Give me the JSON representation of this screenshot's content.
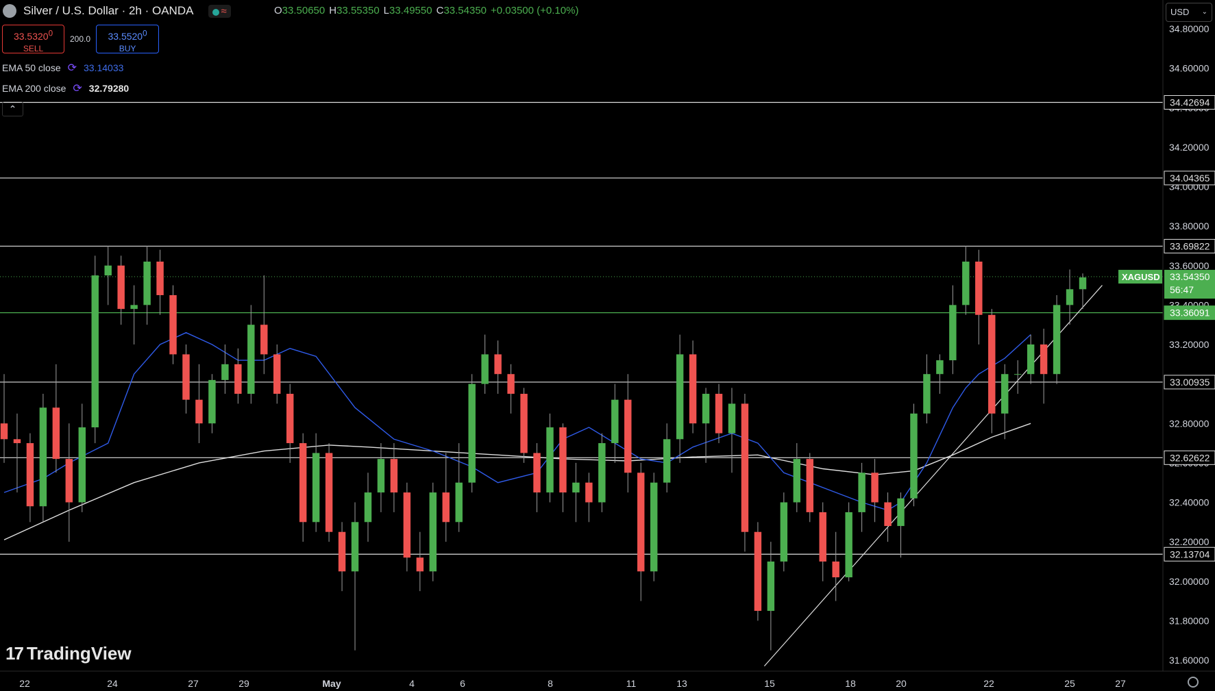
{
  "header": {
    "title": "Silver / U.S. Dollar · 2h · OANDA",
    "ohlc": {
      "o_label": "O",
      "o": "33.50650",
      "h_label": "H",
      "h": "33.55350",
      "l_label": "L",
      "l": "33.49550",
      "c_label": "C",
      "c": "33.54350",
      "change": "+0.03500 (+0.10%)"
    }
  },
  "trade": {
    "sell_price": "33.5320",
    "sell_price_small": "0",
    "sell_label": "SELL",
    "spread": "200.0",
    "buy_price": "33.5520",
    "buy_price_small": "0",
    "buy_label": "BUY"
  },
  "indicators": {
    "ema50_label": "EMA 50 close",
    "ema50_value": "33.14033",
    "ema200_label": "EMA 200 close",
    "ema200_value": "32.79280"
  },
  "currency_select": "USD",
  "collapse_icon": "chevron-up-icon",
  "brand": "TradingView",
  "colors": {
    "up": "#4caf50",
    "down": "#ef5350",
    "ema50": "#2f5bea",
    "ema200": "#e0e0e0",
    "last_price_badge": "#4caf50"
  },
  "chart_data": {
    "type": "candlestick",
    "symbol": "XAGUSD",
    "interval": "2h",
    "ylim": [
      31.55,
      34.85
    ],
    "y_ticks": [
      "34.80000",
      "34.60000",
      "34.40000",
      "34.20000",
      "34.00000",
      "33.80000",
      "33.60000",
      "33.40000",
      "33.20000",
      "33.00000",
      "32.80000",
      "32.60000",
      "32.40000",
      "32.20000",
      "32.00000",
      "31.80000",
      "31.60000"
    ],
    "x_tick_labels": [
      "22",
      "24",
      "27",
      "29",
      "May",
      "4",
      "6",
      "8",
      "11",
      "13",
      "15",
      "18",
      "20",
      "22",
      "25",
      "27"
    ],
    "horizontal_levels": [
      "34.42694",
      "34.04365",
      "33.69822",
      "33.36091",
      "33.00935",
      "32.62622",
      "32.13704"
    ],
    "highlighted_level": "33.36091",
    "last_price": {
      "symbol": "XAGUSD",
      "price": "33.54350",
      "countdown": "56:47"
    },
    "ema50_points": [
      [
        0,
        32.45
      ],
      [
        3,
        32.52
      ],
      [
        5,
        32.6
      ],
      [
        8,
        32.7
      ],
      [
        10,
        33.05
      ],
      [
        12,
        33.2
      ],
      [
        14,
        33.26
      ],
      [
        16,
        33.2
      ],
      [
        18,
        33.12
      ],
      [
        20,
        33.12
      ],
      [
        22,
        33.18
      ],
      [
        24,
        33.14
      ],
      [
        27,
        32.88
      ],
      [
        30,
        32.72
      ],
      [
        33,
        32.66
      ],
      [
        36,
        32.58
      ],
      [
        38,
        32.5
      ],
      [
        41,
        32.55
      ],
      [
        43,
        32.72
      ],
      [
        45,
        32.78
      ],
      [
        47,
        32.7
      ],
      [
        49,
        32.62
      ],
      [
        51,
        32.6
      ],
      [
        53,
        32.68
      ],
      [
        56,
        32.75
      ],
      [
        58,
        32.7
      ],
      [
        60,
        32.55
      ],
      [
        62,
        32.5
      ],
      [
        64,
        32.45
      ],
      [
        66,
        32.4
      ],
      [
        68,
        32.36
      ],
      [
        69,
        32.4
      ],
      [
        71,
        32.6
      ],
      [
        73,
        32.88
      ],
      [
        74,
        32.98
      ],
      [
        75,
        33.05
      ],
      [
        77,
        33.13
      ],
      [
        79,
        33.25
      ]
    ],
    "ema200_points": [
      [
        0,
        32.21
      ],
      [
        5,
        32.36
      ],
      [
        10,
        32.5
      ],
      [
        15,
        32.6
      ],
      [
        20,
        32.66
      ],
      [
        25,
        32.69
      ],
      [
        28,
        32.68
      ],
      [
        33,
        32.66
      ],
      [
        38,
        32.64
      ],
      [
        43,
        32.62
      ],
      [
        48,
        32.61
      ],
      [
        53,
        32.63
      ],
      [
        58,
        32.64
      ],
      [
        63,
        32.57
      ],
      [
        67,
        32.54
      ],
      [
        70,
        32.56
      ],
      [
        73,
        32.64
      ],
      [
        76,
        32.73
      ],
      [
        79,
        32.8
      ]
    ],
    "trendline": [
      [
        58.5,
        31.57
      ],
      [
        84.5,
        33.5
      ]
    ],
    "candles": [
      [
        32.8,
        33.05,
        32.6,
        32.72
      ],
      [
        32.72,
        32.85,
        32.45,
        32.7
      ],
      [
        32.7,
        32.75,
        32.3,
        32.38
      ],
      [
        32.38,
        32.95,
        32.3,
        32.88
      ],
      [
        32.88,
        33.1,
        32.55,
        32.62
      ],
      [
        32.62,
        32.8,
        32.2,
        32.4
      ],
      [
        32.4,
        32.9,
        32.35,
        32.78
      ],
      [
        32.78,
        33.65,
        32.7,
        33.55
      ],
      [
        33.55,
        33.7,
        33.4,
        33.6
      ],
      [
        33.6,
        33.65,
        33.3,
        33.38
      ],
      [
        33.38,
        33.5,
        33.2,
        33.4
      ],
      [
        33.4,
        33.7,
        33.3,
        33.62
      ],
      [
        33.62,
        33.68,
        33.35,
        33.45
      ],
      [
        33.45,
        33.5,
        33.1,
        33.15
      ],
      [
        33.15,
        33.2,
        32.85,
        32.92
      ],
      [
        32.92,
        33.1,
        32.7,
        32.8
      ],
      [
        32.8,
        33.05,
        32.75,
        33.02
      ],
      [
        33.02,
        33.2,
        32.95,
        33.1
      ],
      [
        33.1,
        33.18,
        32.9,
        32.95
      ],
      [
        32.95,
        33.4,
        32.9,
        33.3
      ],
      [
        33.3,
        33.55,
        33.05,
        33.15
      ],
      [
        33.15,
        33.2,
        32.9,
        32.95
      ],
      [
        32.95,
        33.0,
        32.6,
        32.7
      ],
      [
        32.7,
        32.75,
        32.2,
        32.3
      ],
      [
        32.3,
        32.75,
        32.25,
        32.65
      ],
      [
        32.65,
        32.7,
        32.2,
        32.25
      ],
      [
        32.25,
        32.3,
        31.95,
        32.05
      ],
      [
        32.05,
        32.4,
        31.65,
        32.3
      ],
      [
        32.3,
        32.55,
        32.2,
        32.45
      ],
      [
        32.45,
        32.7,
        32.35,
        32.62
      ],
      [
        32.62,
        32.7,
        32.35,
        32.45
      ],
      [
        32.45,
        32.5,
        32.05,
        32.12
      ],
      [
        32.12,
        32.25,
        31.95,
        32.05
      ],
      [
        32.05,
        32.5,
        32.0,
        32.45
      ],
      [
        32.45,
        32.65,
        32.2,
        32.3
      ],
      [
        32.3,
        32.7,
        32.25,
        32.5
      ],
      [
        32.5,
        33.05,
        32.45,
        33.0
      ],
      [
        33.0,
        33.25,
        32.95,
        33.15
      ],
      [
        33.15,
        33.22,
        32.95,
        33.05
      ],
      [
        33.05,
        33.1,
        32.85,
        32.95
      ],
      [
        32.95,
        32.98,
        32.6,
        32.65
      ],
      [
        32.65,
        32.7,
        32.35,
        32.45
      ],
      [
        32.45,
        32.85,
        32.4,
        32.78
      ],
      [
        32.78,
        32.8,
        32.35,
        32.45
      ],
      [
        32.45,
        32.6,
        32.3,
        32.5
      ],
      [
        32.5,
        32.55,
        32.3,
        32.4
      ],
      [
        32.4,
        32.75,
        32.35,
        32.7
      ],
      [
        32.7,
        33.0,
        32.6,
        32.92
      ],
      [
        32.92,
        33.05,
        32.45,
        32.55
      ],
      [
        32.55,
        32.6,
        31.9,
        32.05
      ],
      [
        32.05,
        32.55,
        32.0,
        32.5
      ],
      [
        32.5,
        32.8,
        32.45,
        32.72
      ],
      [
        32.72,
        33.25,
        32.6,
        33.15
      ],
      [
        33.15,
        33.22,
        32.75,
        32.8
      ],
      [
        32.8,
        32.98,
        32.6,
        32.95
      ],
      [
        32.95,
        33.0,
        32.7,
        32.75
      ],
      [
        32.75,
        32.98,
        32.55,
        32.9
      ],
      [
        32.9,
        32.95,
        32.15,
        32.25
      ],
      [
        32.25,
        32.3,
        31.8,
        31.85
      ],
      [
        31.85,
        32.2,
        31.65,
        32.1
      ],
      [
        32.1,
        32.45,
        32.05,
        32.4
      ],
      [
        32.4,
        32.7,
        32.35,
        32.62
      ],
      [
        32.62,
        32.65,
        32.3,
        32.35
      ],
      [
        32.35,
        32.4,
        32.0,
        32.1
      ],
      [
        32.1,
        32.25,
        31.9,
        32.02
      ],
      [
        32.02,
        32.4,
        32.0,
        32.35
      ],
      [
        32.35,
        32.6,
        32.25,
        32.55
      ],
      [
        32.55,
        32.62,
        32.3,
        32.4
      ],
      [
        32.4,
        32.45,
        32.2,
        32.28
      ],
      [
        32.28,
        32.45,
        32.12,
        32.42
      ],
      [
        32.42,
        32.9,
        32.38,
        32.85
      ],
      [
        32.85,
        33.15,
        32.8,
        33.05
      ],
      [
        33.05,
        33.15,
        32.95,
        33.12
      ],
      [
        33.12,
        33.5,
        33.05,
        33.4
      ],
      [
        33.4,
        33.7,
        33.35,
        33.62
      ],
      [
        33.62,
        33.68,
        33.2,
        33.35
      ],
      [
        33.35,
        33.38,
        32.75,
        32.85
      ],
      [
        32.85,
        33.1,
        32.72,
        33.05
      ],
      [
        33.05,
        33.12,
        32.95,
        33.05
      ],
      [
        33.05,
        33.25,
        33.0,
        33.2
      ],
      [
        33.2,
        33.28,
        32.9,
        33.05
      ],
      [
        33.05,
        33.45,
        33.0,
        33.4
      ],
      [
        33.4,
        33.58,
        33.3,
        33.48
      ],
      [
        33.48,
        33.56,
        33.38,
        33.54
      ]
    ]
  }
}
